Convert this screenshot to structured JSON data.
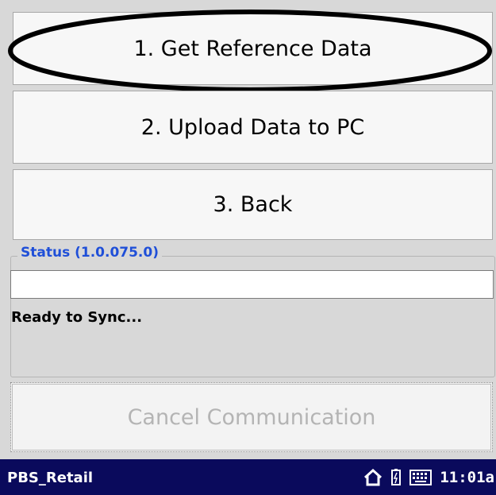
{
  "menu": {
    "button_1_label": "1. Get Reference Data",
    "button_2_label": "2. Upload Data to PC",
    "button_3_label": "3. Back"
  },
  "status": {
    "legend": "Status (1.0.075.0)",
    "progress": 0,
    "message": "Ready to Sync..."
  },
  "cancel_button": {
    "label": "Cancel Communication",
    "enabled": false
  },
  "taskbar": {
    "title": "PBS_Retail",
    "tray_icons": [
      "home-icon",
      "battery-icon",
      "keyboard-icon"
    ],
    "time": "11:01a"
  },
  "colors": {
    "background": "#d8d8d8",
    "button_face": "#f7f7f7",
    "status_legend": "#1f4fd8",
    "taskbar": "#0a0a5c",
    "disabled_text": "#b4b4b4"
  }
}
